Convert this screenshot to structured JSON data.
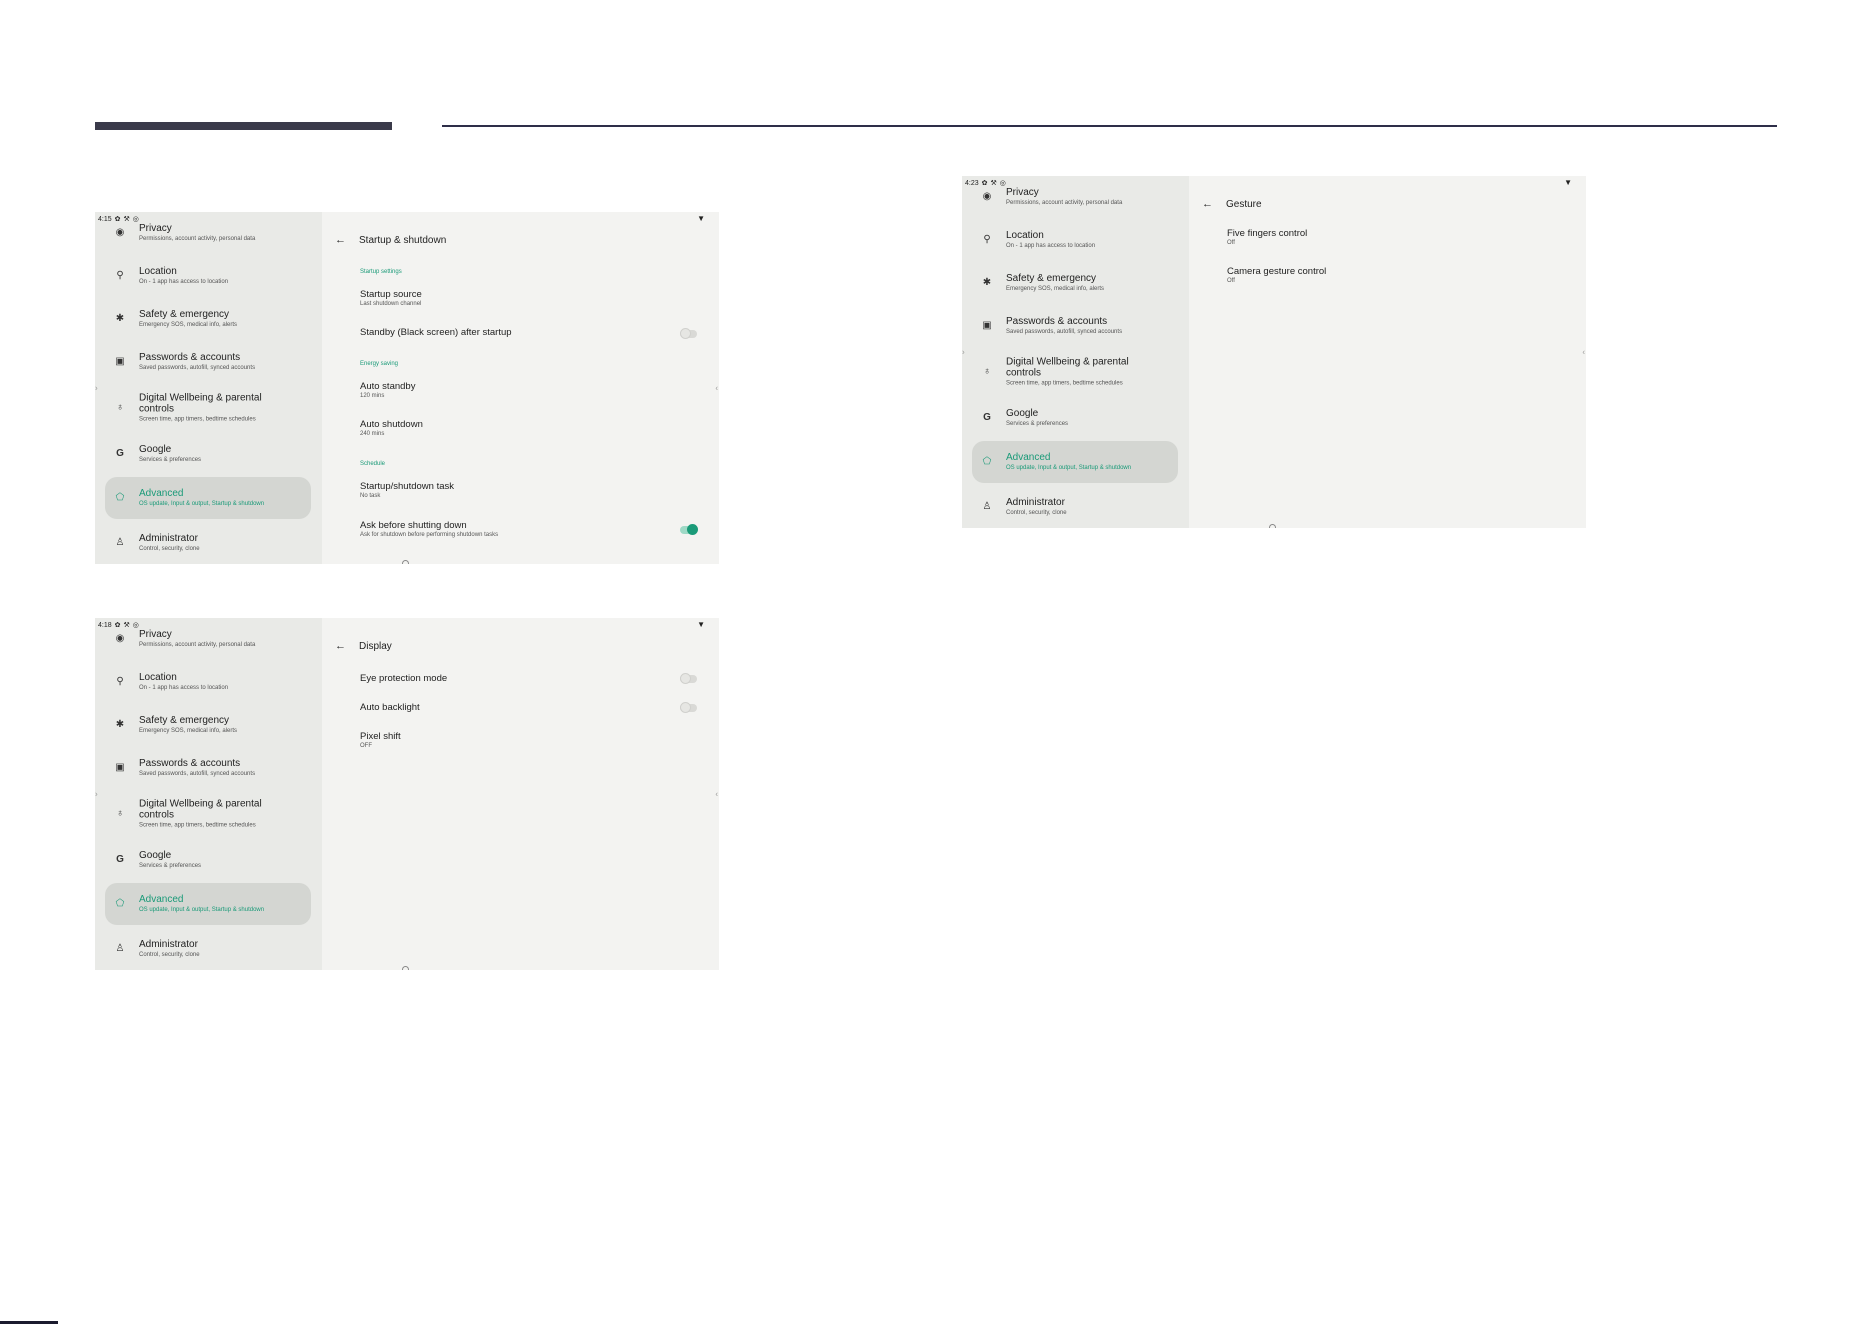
{
  "sidebar_items": {
    "privacy": {
      "label": "Privacy",
      "sub": "Permissions, account activity, personal data",
      "icon": "privacy-eye-icon"
    },
    "location": {
      "label": "Location",
      "sub": "On - 1 app has access to location",
      "icon": "location-pin-icon"
    },
    "safety": {
      "label": "Safety & emergency",
      "sub": "Emergency SOS, medical info, alerts",
      "icon": "asterisk-icon"
    },
    "passwords": {
      "label": "Passwords & accounts",
      "sub": "Saved passwords, autofill, synced accounts",
      "icon": "account-box-icon"
    },
    "wellbeing": {
      "label": "Digital Wellbeing & parental controls",
      "sub": "Screen time, app timers, bedtime schedules",
      "icon": "wellbeing-icon"
    },
    "google": {
      "label": "Google",
      "sub": "Services & preferences",
      "icon": "google-g-icon"
    },
    "advanced": {
      "label": "Advanced",
      "sub": "OS update, Input & output, Startup & shutdown",
      "icon": "advanced-icon"
    },
    "administrator": {
      "label": "Administrator",
      "sub": "Control, security, clone",
      "icon": "person-icon"
    }
  },
  "colors": {
    "accent": "#1a9a78",
    "selected_bg": "#d4d6d2",
    "sidebar_bg": "#e9eae7",
    "content_bg": "#f3f3f1"
  },
  "screens": {
    "startup": {
      "time": "4:15",
      "title": "Startup & shutdown",
      "sections": {
        "startup_settings": "Startup settings",
        "energy_saving": "Energy saving",
        "schedule": "Schedule"
      },
      "items": {
        "startup_source": {
          "title": "Startup source",
          "sub": "Last shutdown channel"
        },
        "standby": {
          "title": "Standby (Black screen) after startup",
          "toggle": "off"
        },
        "auto_standby": {
          "title": "Auto standby",
          "sub": "120 mins"
        },
        "auto_shutdown": {
          "title": "Auto shutdown",
          "sub": "240 mins"
        },
        "task": {
          "title": "Startup/shutdown task",
          "sub": "No task"
        },
        "ask": {
          "title": "Ask before shutting down",
          "sub": "Ask for shutdown before performing shutdown tasks",
          "toggle": "on"
        }
      }
    },
    "display": {
      "time": "4:18",
      "title": "Display",
      "items": {
        "eye": {
          "title": "Eye protection mode",
          "toggle": "off"
        },
        "backlight": {
          "title": "Auto backlight",
          "toggle": "off"
        },
        "pixel": {
          "title": "Pixel shift",
          "sub": "OFF"
        }
      }
    },
    "gesture": {
      "time": "4:23",
      "title": "Gesture",
      "items": {
        "five": {
          "title": "Five fingers control",
          "sub": "Off"
        },
        "camera": {
          "title": "Camera gesture control",
          "sub": "Off"
        }
      }
    }
  }
}
